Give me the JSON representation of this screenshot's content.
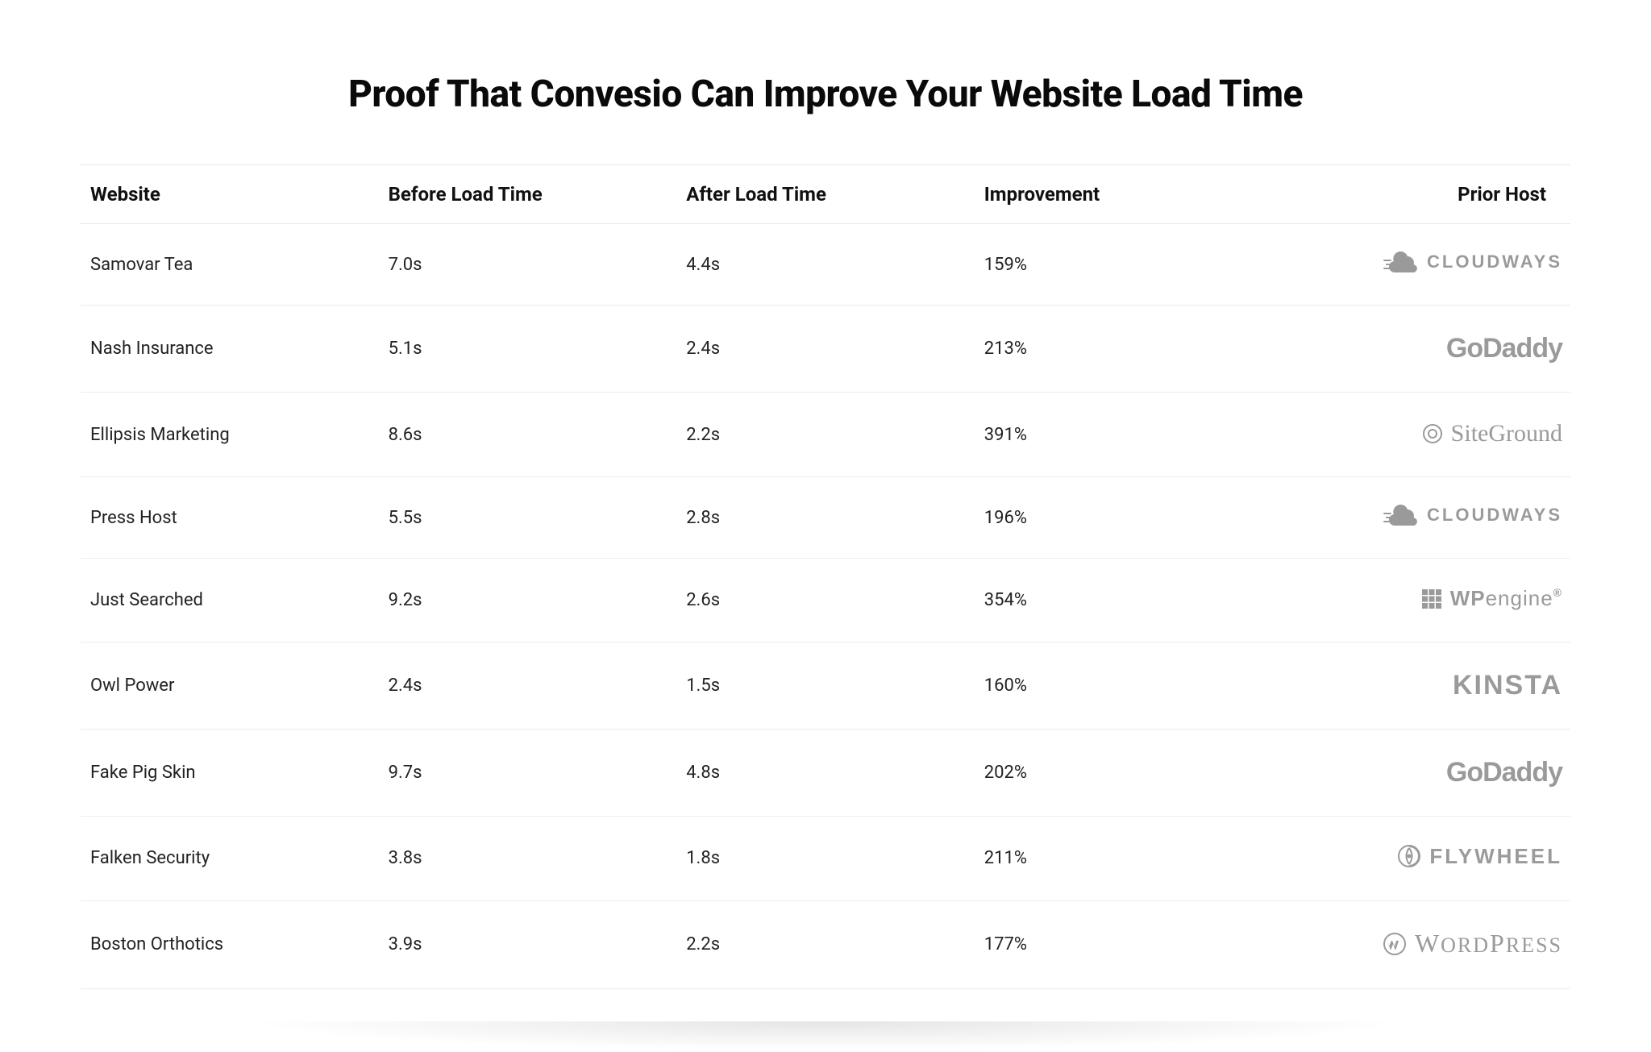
{
  "title": "Proof That Convesio Can Improve Your Website Load Time",
  "columns": {
    "website": "Website",
    "before": "Before Load Time",
    "after": "After Load Time",
    "improvement": "Improvement",
    "prior_host": "Prior Host"
  },
  "rows": [
    {
      "website": "Samovar Tea",
      "before": "7.0s",
      "after": "4.4s",
      "improvement": "159%",
      "host_key": "cloudways",
      "host_label": "CLOUDWAYS"
    },
    {
      "website": "Nash Insurance",
      "before": "5.1s",
      "after": "2.4s",
      "improvement": "213%",
      "host_key": "godaddy",
      "host_label": "GoDaddy"
    },
    {
      "website": "Ellipsis Marketing",
      "before": "8.6s",
      "after": "2.2s",
      "improvement": "391%",
      "host_key": "siteground",
      "host_label": "SiteGround"
    },
    {
      "website": "Press Host",
      "before": "5.5s",
      "after": "2.8s",
      "improvement": "196%",
      "host_key": "cloudways",
      "host_label": "CLOUDWAYS"
    },
    {
      "website": "Just Searched",
      "before": "9.2s",
      "after": "2.6s",
      "improvement": "354%",
      "host_key": "wpengine",
      "host_label": "WPengine"
    },
    {
      "website": "Owl Power",
      "before": "2.4s",
      "after": "1.5s",
      "improvement": "160%",
      "host_key": "kinsta",
      "host_label": "KINSTA"
    },
    {
      "website": "Fake Pig Skin",
      "before": "9.7s",
      "after": "4.8s",
      "improvement": "202%",
      "host_key": "godaddy",
      "host_label": "GoDaddy"
    },
    {
      "website": "Falken Security",
      "before": "3.8s",
      "after": "1.8s",
      "improvement": "211%",
      "host_key": "flywheel",
      "host_label": "FLYWHEEL"
    },
    {
      "website": "Boston Orthotics",
      "before": "3.9s",
      "after": "2.2s",
      "improvement": "177%",
      "host_key": "wordpress",
      "host_label": "WordPress"
    }
  ],
  "chart_data": {
    "type": "table",
    "title": "Proof That Convesio Can Improve Your Website Load Time",
    "columns": [
      "Website",
      "Before Load Time (s)",
      "After Load Time (s)",
      "Improvement (%)",
      "Prior Host"
    ],
    "rows": [
      [
        "Samovar Tea",
        7.0,
        4.4,
        159,
        "Cloudways"
      ],
      [
        "Nash Insurance",
        5.1,
        2.4,
        213,
        "GoDaddy"
      ],
      [
        "Ellipsis Marketing",
        8.6,
        2.2,
        391,
        "SiteGround"
      ],
      [
        "Press Host",
        5.5,
        2.8,
        196,
        "Cloudways"
      ],
      [
        "Just Searched",
        9.2,
        2.6,
        354,
        "WP Engine"
      ],
      [
        "Owl Power",
        2.4,
        1.5,
        160,
        "Kinsta"
      ],
      [
        "Fake Pig Skin",
        9.7,
        4.8,
        202,
        "GoDaddy"
      ],
      [
        "Falken Security",
        3.8,
        1.8,
        211,
        "Flywheel"
      ],
      [
        "Boston Orthotics",
        3.9,
        2.2,
        177,
        "WordPress"
      ]
    ]
  }
}
